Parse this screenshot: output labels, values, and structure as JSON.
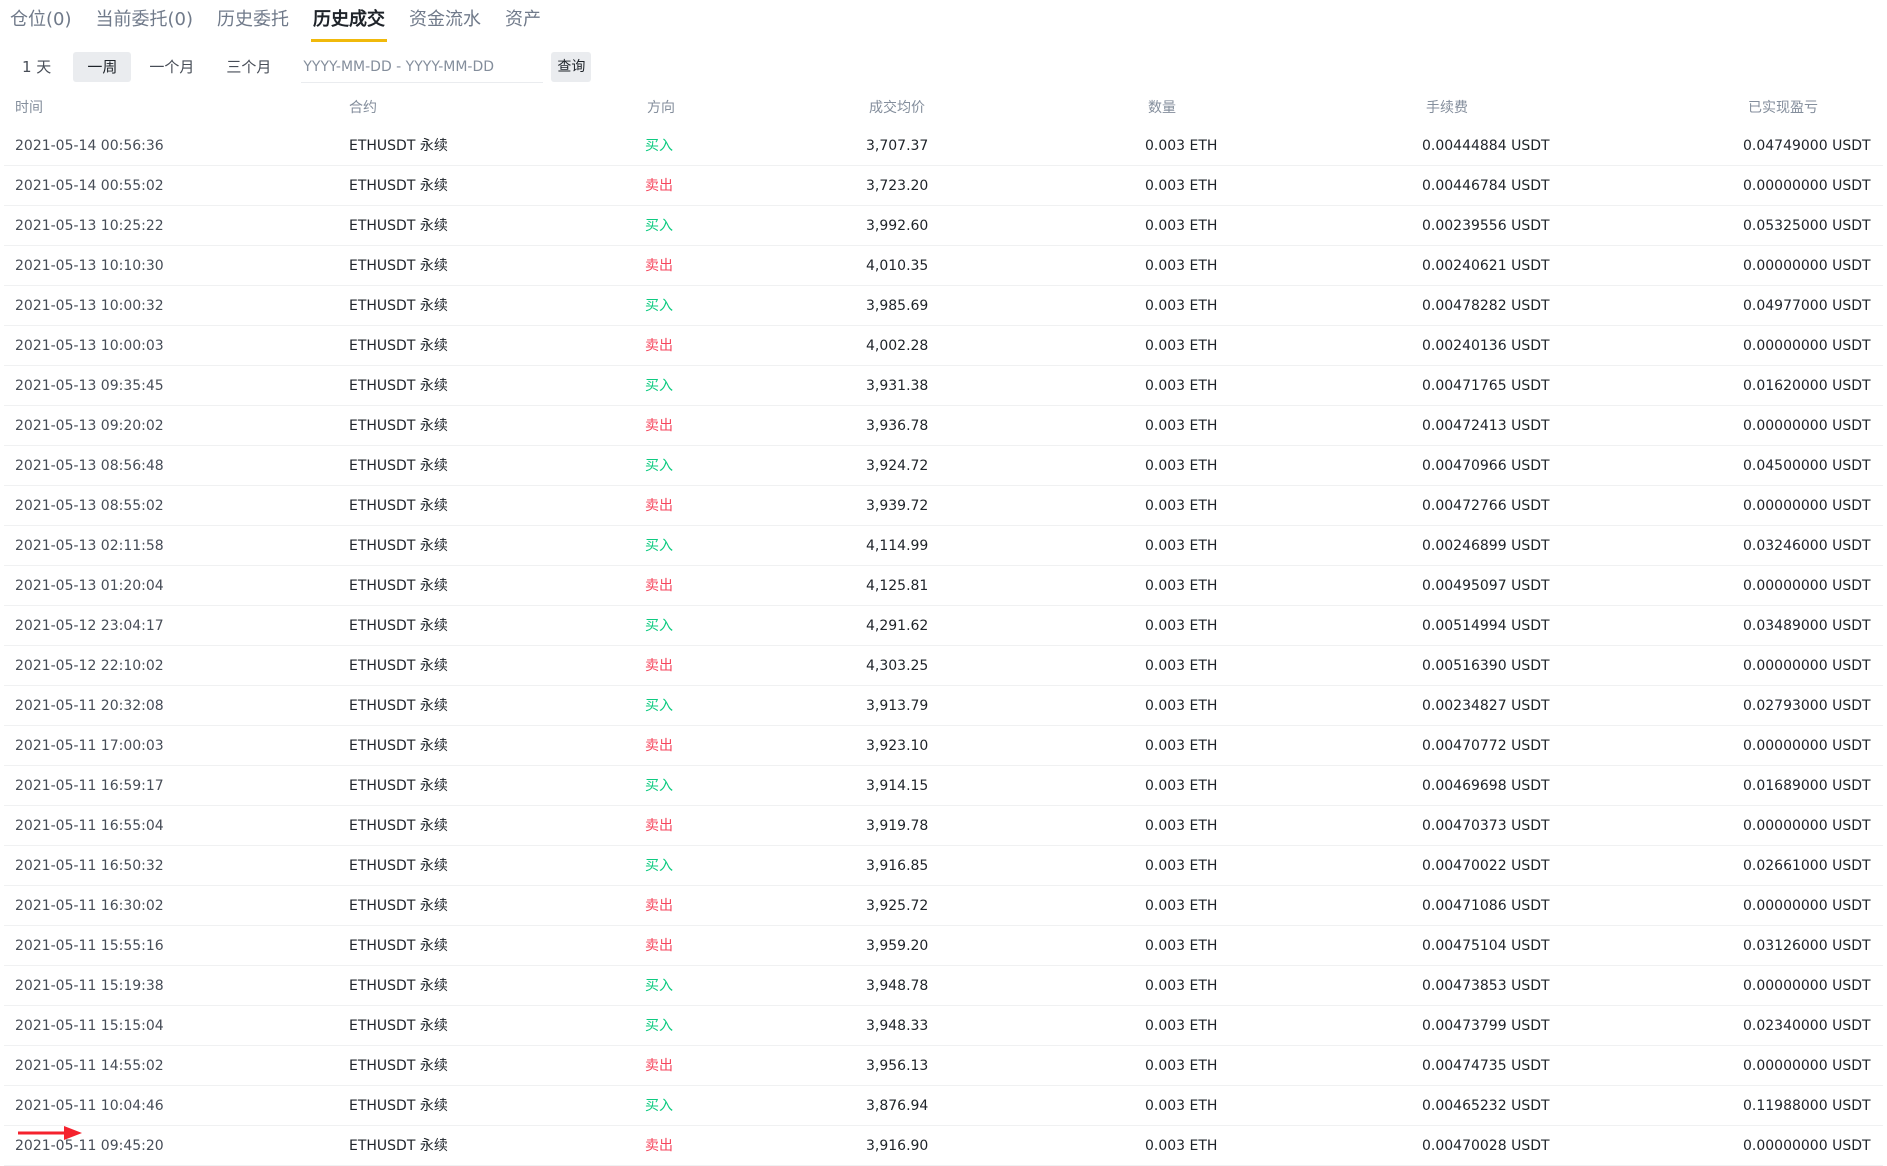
{
  "colors": {
    "accent": "#f0b90b",
    "buy": "#0ecb81",
    "sell": "#f6465d",
    "arrow": "#f5222d"
  },
  "tabs": [
    {
      "label": "仓位(0)",
      "active": false
    },
    {
      "label": "当前委托(0)",
      "active": false
    },
    {
      "label": "历史委托",
      "active": false
    },
    {
      "label": "历史成交",
      "active": true
    },
    {
      "label": "资金流水",
      "active": false
    },
    {
      "label": "资产",
      "active": false
    }
  ],
  "filters": {
    "periods": [
      {
        "label": "1 天",
        "active": false
      },
      {
        "label": "一周",
        "active": true
      },
      {
        "label": "一个月",
        "active": false
      },
      {
        "label": "三个月",
        "active": false
      }
    ],
    "date_placeholder": "YYYY-MM-DD - YYYY-MM-DD",
    "query_label": "查询"
  },
  "table": {
    "headers": {
      "time": "时间",
      "symbol": "合约",
      "side": "方向",
      "price": "成交均价",
      "qty": "数量",
      "fee": "手续费",
      "pnl": "已实现盈亏"
    },
    "rows": [
      {
        "time": "2021-05-14 00:56:36",
        "symbol": "ETHUSDT 永续",
        "side": "买入",
        "side_type": "buy",
        "price": "3,707.37",
        "qty": "0.003 ETH",
        "fee": "0.00444884 USDT",
        "pnl": "0.04749000 USDT"
      },
      {
        "time": "2021-05-14 00:55:02",
        "symbol": "ETHUSDT 永续",
        "side": "卖出",
        "side_type": "sell",
        "price": "3,723.20",
        "qty": "0.003 ETH",
        "fee": "0.00446784 USDT",
        "pnl": "0.00000000 USDT"
      },
      {
        "time": "2021-05-13 10:25:22",
        "symbol": "ETHUSDT 永续",
        "side": "买入",
        "side_type": "buy",
        "price": "3,992.60",
        "qty": "0.003 ETH",
        "fee": "0.00239556 USDT",
        "pnl": "0.05325000 USDT"
      },
      {
        "time": "2021-05-13 10:10:30",
        "symbol": "ETHUSDT 永续",
        "side": "卖出",
        "side_type": "sell",
        "price": "4,010.35",
        "qty": "0.003 ETH",
        "fee": "0.00240621 USDT",
        "pnl": "0.00000000 USDT"
      },
      {
        "time": "2021-05-13 10:00:32",
        "symbol": "ETHUSDT 永续",
        "side": "买入",
        "side_type": "buy",
        "price": "3,985.69",
        "qty": "0.003 ETH",
        "fee": "0.00478282 USDT",
        "pnl": "0.04977000 USDT"
      },
      {
        "time": "2021-05-13 10:00:03",
        "symbol": "ETHUSDT 永续",
        "side": "卖出",
        "side_type": "sell",
        "price": "4,002.28",
        "qty": "0.003 ETH",
        "fee": "0.00240136 USDT",
        "pnl": "0.00000000 USDT"
      },
      {
        "time": "2021-05-13 09:35:45",
        "symbol": "ETHUSDT 永续",
        "side": "买入",
        "side_type": "buy",
        "price": "3,931.38",
        "qty": "0.003 ETH",
        "fee": "0.00471765 USDT",
        "pnl": "0.01620000 USDT"
      },
      {
        "time": "2021-05-13 09:20:02",
        "symbol": "ETHUSDT 永续",
        "side": "卖出",
        "side_type": "sell",
        "price": "3,936.78",
        "qty": "0.003 ETH",
        "fee": "0.00472413 USDT",
        "pnl": "0.00000000 USDT"
      },
      {
        "time": "2021-05-13 08:56:48",
        "symbol": "ETHUSDT 永续",
        "side": "买入",
        "side_type": "buy",
        "price": "3,924.72",
        "qty": "0.003 ETH",
        "fee": "0.00470966 USDT",
        "pnl": "0.04500000 USDT"
      },
      {
        "time": "2021-05-13 08:55:02",
        "symbol": "ETHUSDT 永续",
        "side": "卖出",
        "side_type": "sell",
        "price": "3,939.72",
        "qty": "0.003 ETH",
        "fee": "0.00472766 USDT",
        "pnl": "0.00000000 USDT"
      },
      {
        "time": "2021-05-13 02:11:58",
        "symbol": "ETHUSDT 永续",
        "side": "买入",
        "side_type": "buy",
        "price": "4,114.99",
        "qty": "0.003 ETH",
        "fee": "0.00246899 USDT",
        "pnl": "0.03246000 USDT"
      },
      {
        "time": "2021-05-13 01:20:04",
        "symbol": "ETHUSDT 永续",
        "side": "卖出",
        "side_type": "sell",
        "price": "4,125.81",
        "qty": "0.003 ETH",
        "fee": "0.00495097 USDT",
        "pnl": "0.00000000 USDT"
      },
      {
        "time": "2021-05-12 23:04:17",
        "symbol": "ETHUSDT 永续",
        "side": "买入",
        "side_type": "buy",
        "price": "4,291.62",
        "qty": "0.003 ETH",
        "fee": "0.00514994 USDT",
        "pnl": "0.03489000 USDT"
      },
      {
        "time": "2021-05-12 22:10:02",
        "symbol": "ETHUSDT 永续",
        "side": "卖出",
        "side_type": "sell",
        "price": "4,303.25",
        "qty": "0.003 ETH",
        "fee": "0.00516390 USDT",
        "pnl": "0.00000000 USDT"
      },
      {
        "time": "2021-05-11 20:32:08",
        "symbol": "ETHUSDT 永续",
        "side": "买入",
        "side_type": "buy",
        "price": "3,913.79",
        "qty": "0.003 ETH",
        "fee": "0.00234827 USDT",
        "pnl": "0.02793000 USDT"
      },
      {
        "time": "2021-05-11 17:00:03",
        "symbol": "ETHUSDT 永续",
        "side": "卖出",
        "side_type": "sell",
        "price": "3,923.10",
        "qty": "0.003 ETH",
        "fee": "0.00470772 USDT",
        "pnl": "0.00000000 USDT"
      },
      {
        "time": "2021-05-11 16:59:17",
        "symbol": "ETHUSDT 永续",
        "side": "买入",
        "side_type": "buy",
        "price": "3,914.15",
        "qty": "0.003 ETH",
        "fee": "0.00469698 USDT",
        "pnl": "0.01689000 USDT"
      },
      {
        "time": "2021-05-11 16:55:04",
        "symbol": "ETHUSDT 永续",
        "side": "卖出",
        "side_type": "sell",
        "price": "3,919.78",
        "qty": "0.003 ETH",
        "fee": "0.00470373 USDT",
        "pnl": "0.00000000 USDT"
      },
      {
        "time": "2021-05-11 16:50:32",
        "symbol": "ETHUSDT 永续",
        "side": "买入",
        "side_type": "buy",
        "price": "3,916.85",
        "qty": "0.003 ETH",
        "fee": "0.00470022 USDT",
        "pnl": "0.02661000 USDT"
      },
      {
        "time": "2021-05-11 16:30:02",
        "symbol": "ETHUSDT 永续",
        "side": "卖出",
        "side_type": "sell",
        "price": "3,925.72",
        "qty": "0.003 ETH",
        "fee": "0.00471086 USDT",
        "pnl": "0.00000000 USDT"
      },
      {
        "time": "2021-05-11 15:55:16",
        "symbol": "ETHUSDT 永续",
        "side": "卖出",
        "side_type": "sell",
        "price": "3,959.20",
        "qty": "0.003 ETH",
        "fee": "0.00475104 USDT",
        "pnl": "0.03126000 USDT"
      },
      {
        "time": "2021-05-11 15:19:38",
        "symbol": "ETHUSDT 永续",
        "side": "买入",
        "side_type": "buy",
        "price": "3,948.78",
        "qty": "0.003 ETH",
        "fee": "0.00473853 USDT",
        "pnl": "0.00000000 USDT"
      },
      {
        "time": "2021-05-11 15:15:04",
        "symbol": "ETHUSDT 永续",
        "side": "买入",
        "side_type": "buy",
        "price": "3,948.33",
        "qty": "0.003 ETH",
        "fee": "0.00473799 USDT",
        "pnl": "0.02340000 USDT"
      },
      {
        "time": "2021-05-11 14:55:02",
        "symbol": "ETHUSDT 永续",
        "side": "卖出",
        "side_type": "sell",
        "price": "3,956.13",
        "qty": "0.003 ETH",
        "fee": "0.00474735 USDT",
        "pnl": "0.00000000 USDT"
      },
      {
        "time": "2021-05-11 10:04:46",
        "symbol": "ETHUSDT 永续",
        "side": "买入",
        "side_type": "buy",
        "price": "3,876.94",
        "qty": "0.003 ETH",
        "fee": "0.00465232 USDT",
        "pnl": "0.11988000 USDT"
      },
      {
        "time": "2021-05-11 09:45:20",
        "symbol": "ETHUSDT 永续",
        "side": "卖出",
        "side_type": "sell",
        "price": "3,916.90",
        "qty": "0.003 ETH",
        "fee": "0.00470028 USDT",
        "pnl": "0.00000000 USDT"
      }
    ]
  },
  "annotation_icon": "red-arrow-icon"
}
